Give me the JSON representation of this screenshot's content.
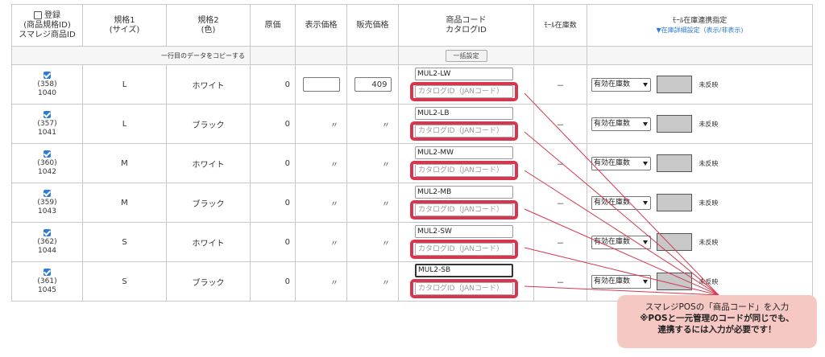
{
  "headers": {
    "register": "登録",
    "register_sub1": "(商品規格ID)",
    "register_sub2": "スマレジ商品ID",
    "spec1": "規格1",
    "spec1_sub": "(サイズ)",
    "spec2": "規格2",
    "spec2_sub": "(色)",
    "cost": "原価",
    "display_price": "表示価格",
    "sale_price": "販売価格",
    "product_code": "商品コード",
    "catalog_id": "カタログID",
    "mall_stock": "ﾓｰﾙ在庫数",
    "mall_link": "ﾓｰﾙ在庫連携指定",
    "mall_link_toggle": "▼在庫詳細設定（表示/非表示)"
  },
  "copy_row": {
    "label": "一行目のデータをコピーする",
    "bulk_button": "一括設定"
  },
  "rows": [
    {
      "spec_id": "(358)",
      "smaregi_id": "1040",
      "size": "L",
      "color": "ホワイト",
      "cost": "0",
      "display_price": "",
      "sale_price": "409",
      "code": "MUL2-LW",
      "catalog_placeholder": "カタログID（JANコード）",
      "mall_stock": "－",
      "stock_select": "有効在庫数",
      "status": "未反映"
    },
    {
      "spec_id": "(357)",
      "smaregi_id": "1041",
      "size": "L",
      "color": "ブラック",
      "cost": "0",
      "display_price": "〃",
      "sale_price": "〃",
      "code": "MUL2-LB",
      "catalog_placeholder": "カタログID（JANコード）",
      "mall_stock": "－",
      "stock_select": "有効在庫数",
      "status": "未反映"
    },
    {
      "spec_id": "(360)",
      "smaregi_id": "1042",
      "size": "M",
      "color": "ホワイト",
      "cost": "0",
      "display_price": "〃",
      "sale_price": "〃",
      "code": "MUL2-MW",
      "catalog_placeholder": "カタログID（JANコード）",
      "mall_stock": "－",
      "stock_select": "有効在庫数",
      "status": "未反映"
    },
    {
      "spec_id": "(359)",
      "smaregi_id": "1043",
      "size": "M",
      "color": "ブラック",
      "cost": "0",
      "display_price": "〃",
      "sale_price": "〃",
      "code": "MUL2-MB",
      "catalog_placeholder": "カタログID（JANコード）",
      "mall_stock": "－",
      "stock_select": "有効在庫数",
      "status": "未反映"
    },
    {
      "spec_id": "(362)",
      "smaregi_id": "1044",
      "size": "S",
      "color": "ホワイト",
      "cost": "0",
      "display_price": "〃",
      "sale_price": "〃",
      "code": "MUL2-SW",
      "catalog_placeholder": "カタログID（JANコード）",
      "mall_stock": "－",
      "stock_select": "有効在庫数",
      "status": "未反映"
    },
    {
      "spec_id": "(361)",
      "smaregi_id": "1045",
      "size": "S",
      "color": "ブラック",
      "cost": "0",
      "display_price": "〃",
      "sale_price": "〃",
      "code": "MUL2-SB",
      "catalog_placeholder": "カタログID（JANコード）",
      "mall_stock": "－",
      "stock_select": "有効在庫数",
      "status": "未反映"
    }
  ],
  "callout": {
    "line1": "スマレジPOSの「商品コード」を入力",
    "line2": "※POSと一元管理のコードが同じでも、",
    "line3": "連携するには入力が必要です！"
  },
  "colors": {
    "highlight": "#d6374f",
    "callout_bg": "#f6c8c4",
    "checkbox": "#2b7bd8"
  }
}
